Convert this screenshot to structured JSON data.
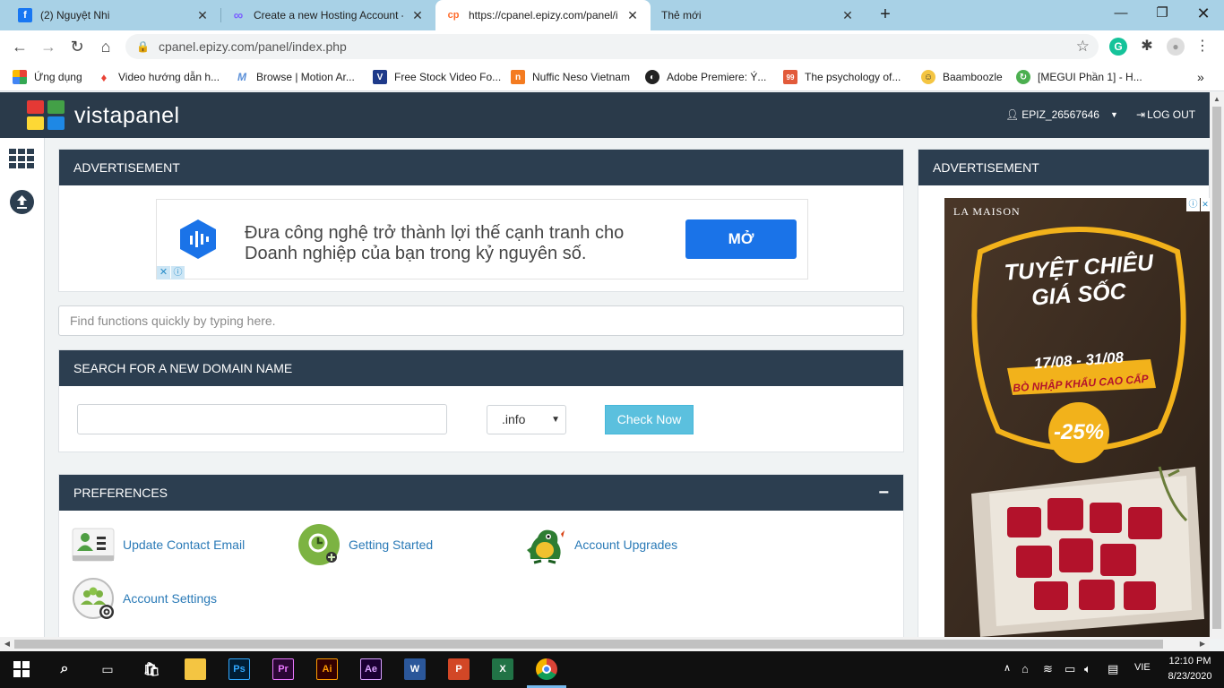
{
  "browser": {
    "tabs": [
      {
        "title": "(2) Nguyệt Nhi",
        "favicon": "f",
        "favicon_color": "#1877f2"
      },
      {
        "title": "Create a new Hosting Account - I",
        "favicon": "∞",
        "favicon_color": "#7b61ff"
      },
      {
        "title": "https://cpanel.epizy.com/panel/i",
        "favicon": "cp",
        "favicon_color": "#ff6c2c"
      },
      {
        "title": "Thẻ mới",
        "favicon": "",
        "favicon_color": "#a8d1e6"
      }
    ],
    "url": "cpanel.epizy.com/panel/index.php",
    "bookmarks": [
      {
        "label": "Ứng dụng",
        "color": "#e94235"
      },
      {
        "label": "Video hướng dẫn h...",
        "color": "#e94235"
      },
      {
        "label": "Browse | Motion Ar...",
        "color": "#5a8fd8"
      },
      {
        "label": "Free Stock Video Fo...",
        "color": "#1e3a8a"
      },
      {
        "label": "Nuffic Neso Vietnam",
        "color": "#f47b20"
      },
      {
        "label": "Adobe Premiere: Ý...",
        "color": "#222222"
      },
      {
        "label": "The psychology of...",
        "color": "#e25a3a"
      },
      {
        "label": "Baamboozle",
        "color": "#f4c542"
      },
      {
        "label": "[MEGUI Phần 1] - H...",
        "color": "#4caf50"
      }
    ]
  },
  "panel": {
    "logo": "vistapanel",
    "username": "EPIZ_26567646",
    "logout": "LOG OUT"
  },
  "main": {
    "advert_title": "ADVERTISEMENT",
    "ad_text": "Đưa công nghệ trở thành lợi thế cạnh tranh cho Doanh nghiệp của bạn trong kỷ nguyên số.",
    "ad_button": "MỞ",
    "search_placeholder": "Find functions quickly by typing here.",
    "domain_title": "SEARCH FOR A NEW DOMAIN NAME",
    "domain_tld": ".info",
    "check_now": "Check Now",
    "prefs_title": "PREFERENCES",
    "prefs_collapse": "−",
    "prefs": [
      {
        "label": "Update Contact Email",
        "icon": "contact-card-icon"
      },
      {
        "label": "Getting Started",
        "icon": "getting-started-icon"
      },
      {
        "label": "Account Upgrades",
        "icon": "dragon-icon"
      },
      {
        "label": "Account Settings",
        "icon": "account-settings-icon"
      }
    ]
  },
  "right": {
    "advert_title": "ADVERTISEMENT",
    "brand": "LA MAISON",
    "headline1": "TUYỆT CHIÊU",
    "headline2": "GIÁ SỐC",
    "dates": "17/08 - 31/08",
    "subhead": "BÒ NHẬP KHẨU CAO CẤP",
    "discount": "-25%"
  },
  "taskbar": {
    "lang": "VIE",
    "time": "12:10 PM",
    "date": "8/23/2020"
  }
}
